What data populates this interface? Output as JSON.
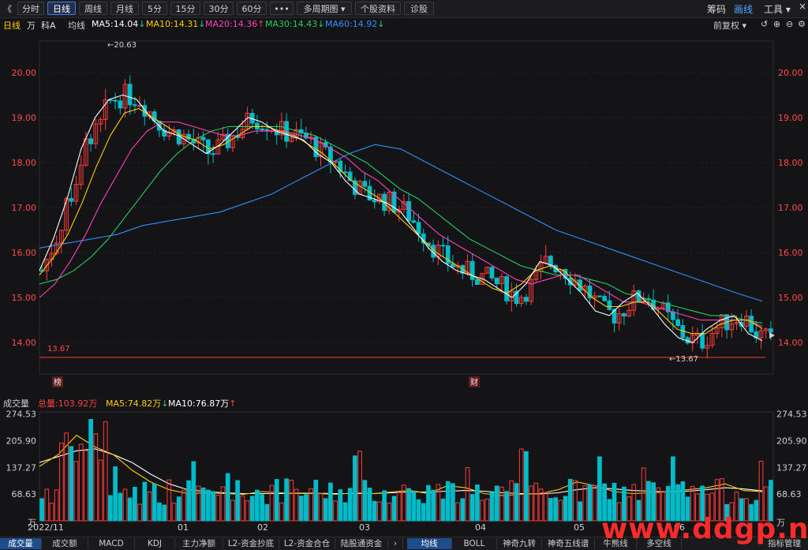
{
  "toolbar": {
    "back": "《",
    "tabs": [
      "分时",
      "日线",
      "周线",
      "月线",
      "5分",
      "15分",
      "30分",
      "60分",
      "•••",
      "多周期图 ▾",
      "个股资料",
      "诊股"
    ],
    "active_tab": "日线",
    "right": [
      "筹码",
      "画线",
      "工具 ▾"
    ],
    "right_active": "画线"
  },
  "info": {
    "period": "日线",
    "unit": "万",
    "name": "科A",
    "ma_label": "均线",
    "ma5": "MA5:14.04",
    "ma10": "MA10:14.31",
    "ma20": "MA20:14.36",
    "ma30": "MA30:14.43",
    "ma60": "MA60:14.92",
    "fq": "前复权",
    "arrow_down": "↓",
    "arrow_up": "↑"
  },
  "volume_info": {
    "title": "成交量",
    "total": "总量:103.92万",
    "ma5": "MA5:74.82万",
    "ma10": "MA10:76.87万",
    "arrow_down": "↓",
    "arrow_up": "↑"
  },
  "markers": {
    "bang": "榜",
    "cai": "财",
    "high_label": "20.63",
    "low_label": "13.67",
    "low_line_label": "13.67"
  },
  "price_axis": [
    "20.00",
    "19.00",
    "18.00",
    "17.00",
    "16.00",
    "15.00",
    "14.00"
  ],
  "volume_axis": [
    "274.53",
    "205.90",
    "137.27",
    "68.63",
    "万"
  ],
  "date_axis": [
    "2022/11",
    "01",
    "02",
    "03",
    "04",
    "05",
    "06"
  ],
  "bottom_tabs": [
    "成交量",
    "成交额",
    "MACD",
    "KDJ",
    "主力净额",
    "L2-资金抄底",
    "L2-资金合仓",
    "陆股通资金",
    "均线",
    "BOLL",
    "神奇九转",
    "神奇五线谱",
    "牛熊线",
    "多空线",
    "指标管理"
  ],
  "bottom_active": [
    "成交量",
    "均线"
  ],
  "watermark": "www.ddgp.net",
  "colors": {
    "up": "#ff3b3b",
    "down": "#00bcc9",
    "ma5": "#ffffff",
    "ma10": "#ffcc00",
    "ma20": "#ff3fbf",
    "ma30": "#20d060",
    "ma60": "#2f8fff"
  },
  "chart_data": {
    "type": "candlestick",
    "price_range": [
      13.3,
      20.7
    ],
    "volume_range": [
      0,
      280
    ],
    "high": 20.63,
    "low": 13.67,
    "ma5": [
      15.6,
      16.3,
      17.2,
      18.3,
      19.0,
      19.4,
      19.5,
      19.4,
      19.0,
      18.7,
      18.6,
      18.4,
      18.2,
      18.4,
      18.7,
      19.0,
      18.9,
      18.7,
      18.6,
      18.5,
      18.2,
      18.0,
      17.6,
      17.3,
      17.2,
      17.1,
      16.9,
      16.5,
      16.1,
      15.8,
      15.6,
      15.5,
      15.4,
      15.2,
      15.0,
      15.3,
      15.8,
      15.7,
      15.4,
      15.1,
      14.7,
      14.6,
      14.9,
      15.1,
      14.8,
      14.4,
      14.1,
      14.0,
      14.3,
      14.5,
      14.6,
      14.2,
      14.04
    ],
    "ma10": [
      15.5,
      15.9,
      16.4,
      17.1,
      17.9,
      18.6,
      19.1,
      19.2,
      19.0,
      18.8,
      18.6,
      18.5,
      18.3,
      18.4,
      18.6,
      18.8,
      18.8,
      18.7,
      18.6,
      18.4,
      18.2,
      17.9,
      17.6,
      17.4,
      17.2,
      16.9,
      16.6,
      16.3,
      16.0,
      15.8,
      15.6,
      15.4,
      15.2,
      15.1,
      15.3,
      15.6,
      15.7,
      15.6,
      15.3,
      15.0,
      14.8,
      14.8,
      14.9,
      14.9,
      14.6,
      14.3,
      14.2,
      14.2,
      14.4,
      14.5,
      14.5,
      14.31
    ],
    "ma20": [
      15.0,
      15.3,
      15.8,
      16.4,
      17.1,
      17.7,
      18.3,
      18.7,
      18.9,
      18.9,
      18.8,
      18.7,
      18.6,
      18.6,
      18.7,
      18.7,
      18.7,
      18.6,
      18.5,
      18.3,
      18.1,
      17.8,
      17.6,
      17.3,
      17.0,
      16.7,
      16.4,
      16.2,
      16.0,
      15.8,
      15.6,
      15.4,
      15.3,
      15.4,
      15.5,
      15.5,
      15.3,
      15.1,
      14.9,
      14.9,
      14.8,
      14.7,
      14.6,
      14.5,
      14.5,
      14.5,
      14.5,
      14.36
    ],
    "ma30": [
      15.3,
      15.4,
      15.6,
      15.9,
      16.3,
      16.8,
      17.3,
      17.8,
      18.2,
      18.5,
      18.7,
      18.8,
      18.8,
      18.8,
      18.8,
      18.7,
      18.6,
      18.4,
      18.2,
      18.0,
      17.7,
      17.4,
      17.2,
      16.9,
      16.6,
      16.3,
      16.1,
      15.9,
      15.7,
      15.6,
      15.5,
      15.5,
      15.4,
      15.3,
      15.1,
      15.0,
      14.9,
      14.8,
      14.7,
      14.6,
      14.6,
      14.5,
      14.43
    ],
    "ma60": [
      16.1,
      16.2,
      16.3,
      16.4,
      16.6,
      16.7,
      16.8,
      16.9,
      17.1,
      17.3,
      17.6,
      17.9,
      18.2,
      18.4,
      18.3,
      18.0,
      17.7,
      17.4,
      17.1,
      16.8,
      16.5,
      16.3,
      16.1,
      15.9,
      15.7,
      15.5,
      15.3,
      15.1,
      14.92
    ],
    "volume_ma5": [
      140,
      170,
      220,
      190,
      170,
      130,
      100,
      80,
      70,
      72,
      70,
      68,
      75,
      72,
      70,
      70,
      68,
      72,
      70,
      74,
      78,
      70,
      90,
      85,
      70,
      65,
      68,
      70,
      80,
      100,
      90,
      75,
      70,
      72,
      75,
      80,
      85,
      95,
      78,
      74.82
    ],
    "volume_ma10": [
      150,
      165,
      180,
      185,
      170,
      150,
      120,
      95,
      80,
      75,
      72,
      70,
      70,
      70,
      71,
      71,
      70,
      70,
      70,
      72,
      74,
      74,
      76,
      78,
      76,
      72,
      70,
      69,
      72,
      80,
      85,
      82,
      78,
      76,
      74,
      76,
      80,
      85,
      82,
      76.87
    ]
  }
}
